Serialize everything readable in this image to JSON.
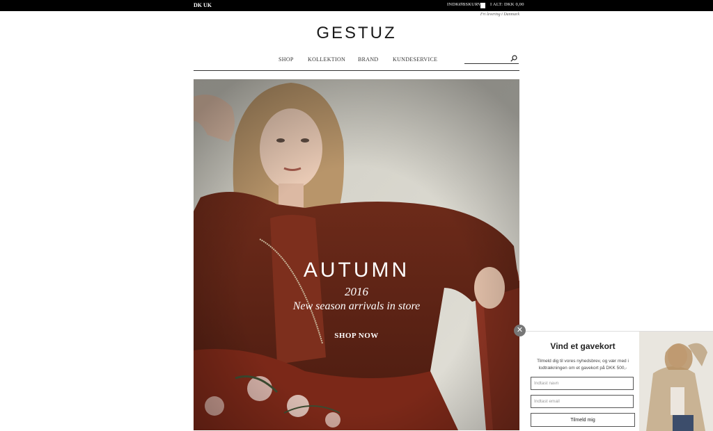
{
  "topbar": {
    "lang_dk": "DK",
    "lang_uk": "UK",
    "cart_label": "INDKØBSKURV",
    "cart_total": "I ALT: DKK 0,00"
  },
  "header": {
    "free_delivery": "Fri levering i Danmark",
    "logo": "GESTUZ"
  },
  "nav": {
    "items": [
      "SHOP",
      "KOLLEKTION",
      "BRAND",
      "KUNDESERVICE"
    ]
  },
  "search": {
    "placeholder": "",
    "icon": "search-icon"
  },
  "hero": {
    "title": "AUTUMN",
    "year": "2016",
    "subtitle": "New season arrivals in store",
    "cta": "SHOP NOW"
  },
  "popup": {
    "close_icon": "close-icon",
    "close_glyph": "✕",
    "title": "Vind et gavekort",
    "text": "Tilmeld dig til vores nyhedsbrev, og vær med i lodtrækningen om et gavekort på DKK 500,-",
    "name_placeholder": "Indtast navn",
    "email_placeholder": "Indtast email",
    "submit": "Tilmeld mig"
  },
  "colors": {
    "topbar": "#000000",
    "hero_jacket": "#7a2f1c",
    "hero_wall": "#d8d6cc"
  }
}
